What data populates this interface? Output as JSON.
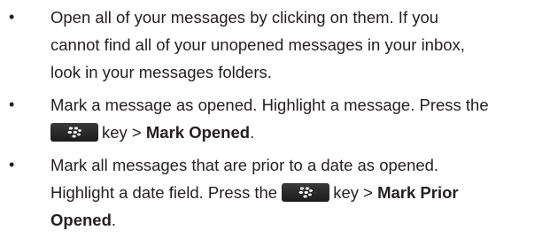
{
  "bullet_glyph": "•",
  "items": [
    {
      "line1": "Open all of your messages by clicking on them. If you",
      "line2": "cannot find all of your unopened messages in your inbox,",
      "line3": "look in your messages folders."
    },
    {
      "line1": "Mark a message as opened. Highlight a message. Press the",
      "line2_after_icon": "key > ",
      "line2_bold": "Mark Opened",
      "line2_end": ".",
      "key_icon": "blackberry-menu-key-icon"
    },
    {
      "line1": "Mark all messages that are prior to a date as opened.",
      "line2_before_icon": "Highlight a date field. Press the",
      "line2_after_icon": "key > ",
      "line2_bold": "Mark Prior",
      "line3_bold": "Opened",
      "line3_end": ".",
      "key_icon": "blackberry-menu-key-icon"
    }
  ],
  "colors": {
    "text": "#231f20",
    "key_background": "#2a2a2a",
    "key_glyph": "#ffffff"
  }
}
